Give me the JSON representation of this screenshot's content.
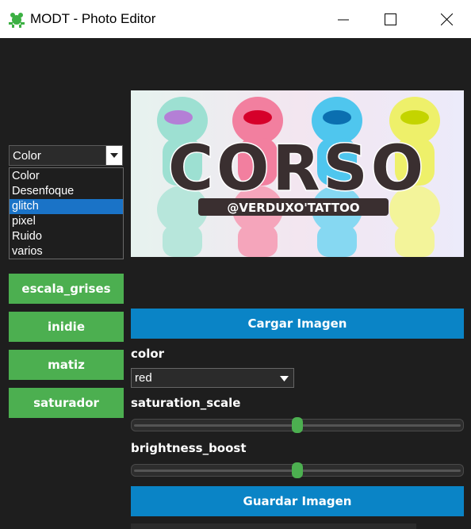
{
  "window": {
    "title": "MODT - Photo Editor",
    "icon": "green-frog-icon"
  },
  "filter_combo": {
    "selected": "Color",
    "options": [
      "Color",
      "Desenfoque",
      "glitch",
      "pixel",
      "Ruido",
      "varios"
    ],
    "highlighted_index": 2
  },
  "side_buttons": [
    "escala_grises",
    "inidie",
    "matiz",
    "saturador"
  ],
  "image": {
    "main_text": "CORSO",
    "caption": "@VERDUXO'TATTOO"
  },
  "load_button": "Cargar Imagen",
  "color_label": "color",
  "color_select": {
    "value": "red"
  },
  "saturation_label": "saturation_scale",
  "saturation_value": 0.5,
  "brightness_label": "brightness_boost",
  "brightness_value": 0.5,
  "save_button": "Guardar Imagen",
  "colors": {
    "green": "#4caf50",
    "blue": "#0a84c6",
    "bg": "#1e1e1e",
    "highlight": "#1a73c7"
  }
}
